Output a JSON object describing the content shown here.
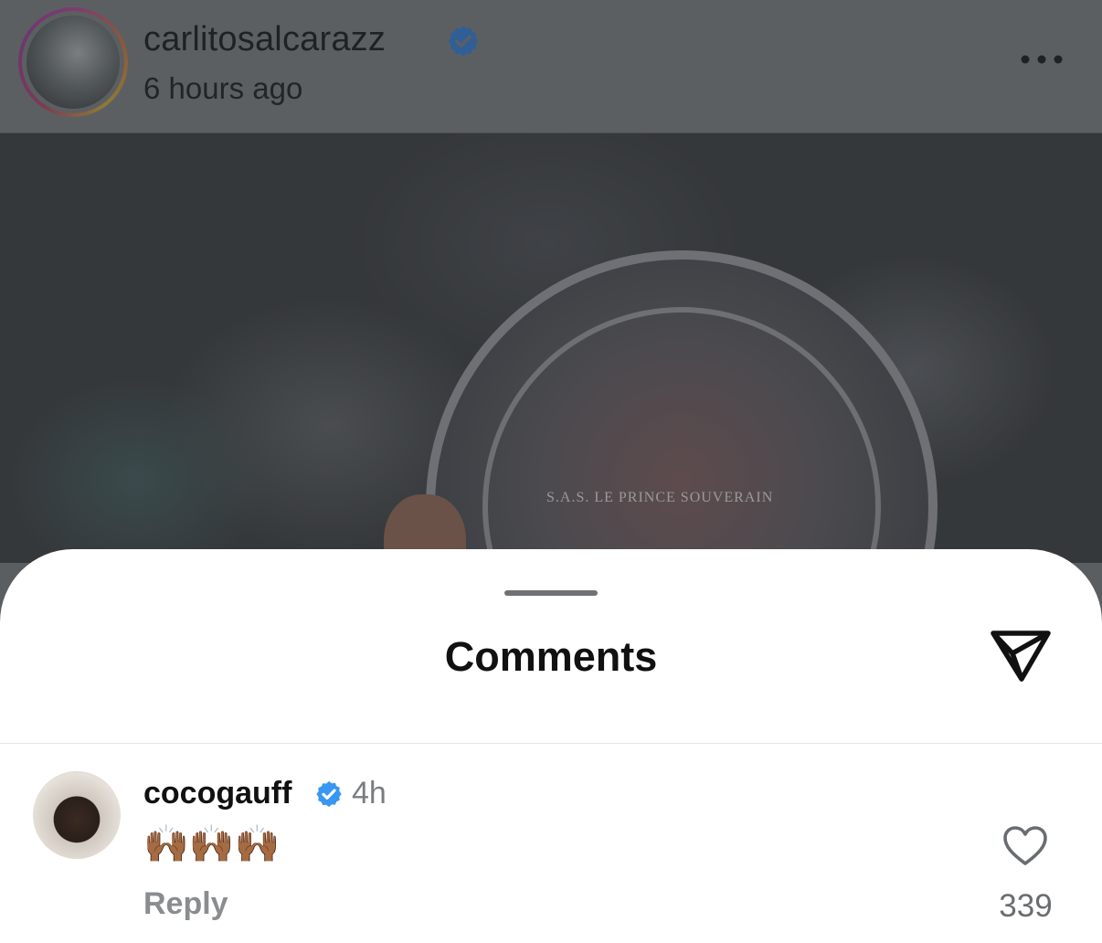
{
  "post": {
    "username": "carlitosalcarazz",
    "time_ago": "6 hours ago",
    "plate_inscription": "S.A.S. LE PRINCE SOUVERAIN"
  },
  "comments_sheet": {
    "title": "Comments"
  },
  "comment": {
    "username": "cocogauff",
    "time": "4h",
    "text": "🙌🏾🙌🏾🙌🏾",
    "reply_label": "Reply",
    "like_count": "339"
  },
  "icons": {
    "verified": "verified-badge-icon",
    "more": "more-options-icon",
    "share": "send-icon",
    "like": "heart-icon"
  },
  "colors": {
    "verified_blue": "#3897f0",
    "overlay": "#5c5f62",
    "sheet": "#ffffff"
  }
}
